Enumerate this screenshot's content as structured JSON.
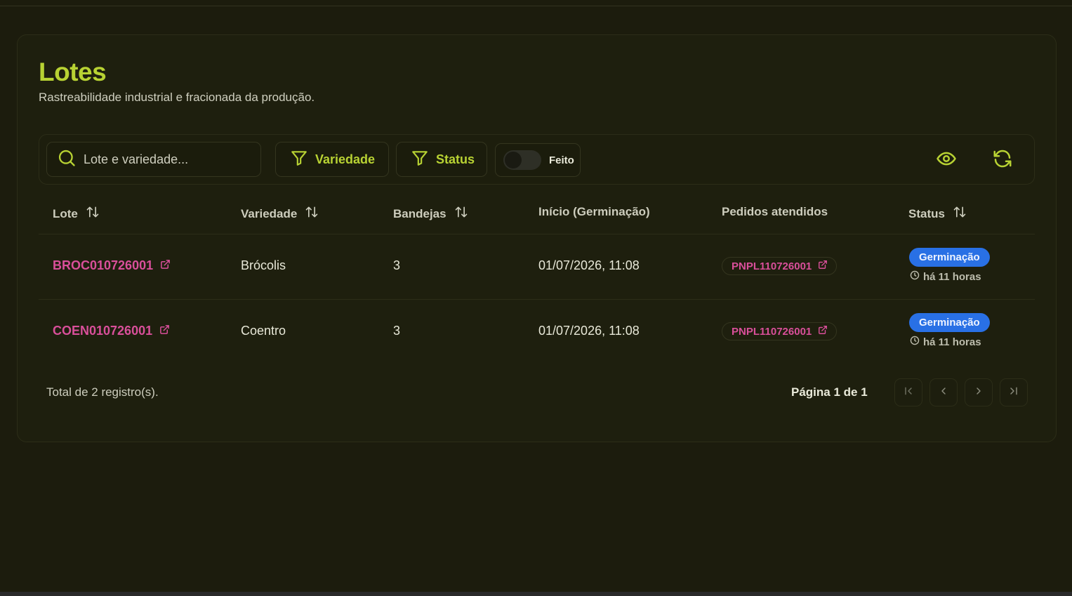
{
  "header": {
    "title": "Lotes",
    "subtitle": "Rastreabilidade industrial e fracionada da produção."
  },
  "toolbar": {
    "search_placeholder": "Lote e variedade...",
    "filter_variedade": "Variedade",
    "filter_status": "Status",
    "toggle_label": "Feito",
    "toggle_on": false
  },
  "table": {
    "columns": [
      "Lote",
      "Variedade",
      "Bandejas",
      "Início (Germinação)",
      "Pedidos atendidos",
      "Status"
    ],
    "rows": [
      {
        "lote": "BROC010726001",
        "variedade": "Brócolis",
        "bandejas": "3",
        "inicio": "01/07/2026, 11:08",
        "pedido": "PNPL110726001",
        "status": "Germinação",
        "tempo": "há 11 horas"
      },
      {
        "lote": "COEN010726001",
        "variedade": "Coentro",
        "bandejas": "3",
        "inicio": "01/07/2026, 11:08",
        "pedido": "PNPL110726001",
        "status": "Germinação",
        "tempo": "há 11 horas"
      }
    ]
  },
  "footer": {
    "total": "Total de 2 registro(s).",
    "page_info": "Página 1 de 1"
  },
  "colors": {
    "accent": "#b8d233",
    "link": "#d94f9a",
    "badge": "#2970e5",
    "background": "#1c1c0d"
  }
}
